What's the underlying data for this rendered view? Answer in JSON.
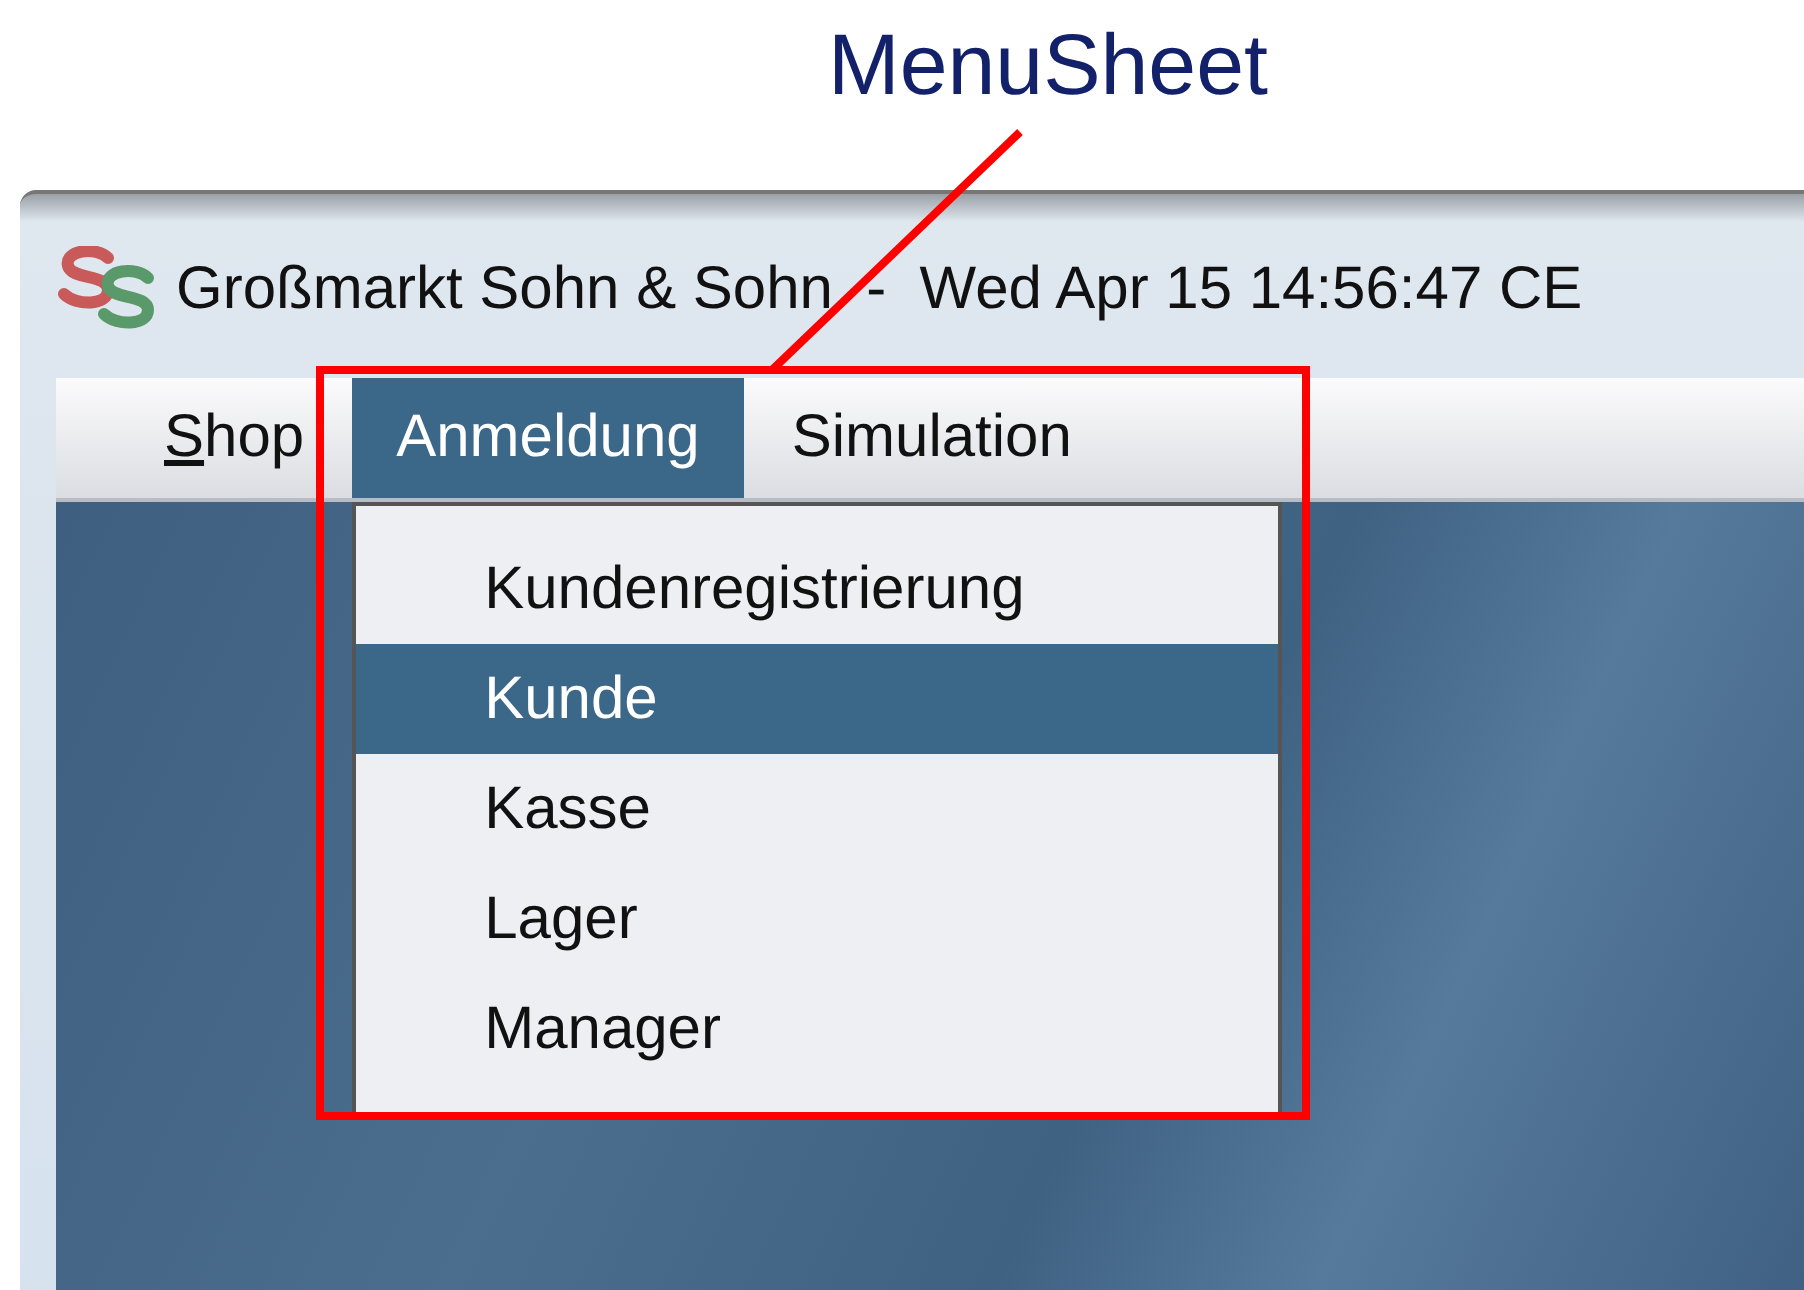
{
  "annotation": {
    "label": "MenuSheet"
  },
  "window": {
    "title": "Großmarkt Sohn & Sohn  -  Wed Apr 15 14:56:47 CE"
  },
  "menubar": [
    {
      "label": "Shop",
      "selected": false,
      "mnemonic": true
    },
    {
      "label": "Anmeldung",
      "selected": true,
      "mnemonic": false
    },
    {
      "label": "Simulation",
      "selected": false,
      "mnemonic": false
    }
  ],
  "menu": {
    "items": [
      {
        "label": "Kundenregistrierung",
        "selected": false
      },
      {
        "label": "Kunde",
        "selected": true
      },
      {
        "label": "Kasse",
        "selected": false
      },
      {
        "label": "Lager",
        "selected": false
      },
      {
        "label": "Manager",
        "selected": false
      }
    ]
  }
}
